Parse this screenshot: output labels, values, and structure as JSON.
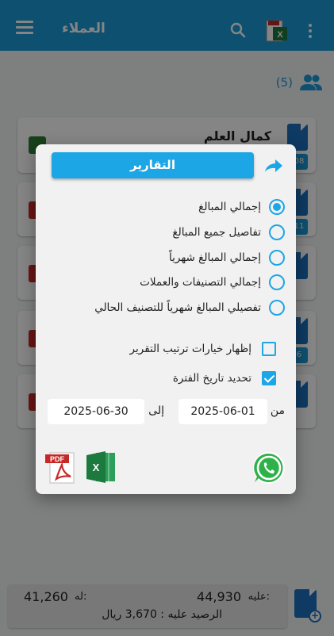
{
  "app": {
    "title": "العملاء",
    "customer_count": "(5)",
    "customers": [
      {
        "name": "كمال العلم",
        "tag": "08"
      },
      {
        "name": "",
        "tag": "11"
      },
      {
        "name": "",
        "tag": ""
      },
      {
        "name": "",
        "tag": "6"
      },
      {
        "name": "",
        "tag": ""
      }
    ],
    "totals": {
      "debit_label": "عليه:",
      "debit_value": "44,930",
      "credit_label": "له:",
      "credit_value": "41,260",
      "balance": "الرصيد عليه : 3,670 ريال"
    }
  },
  "dialog": {
    "title": "التقارير",
    "report_options": [
      {
        "label": "إجمالي المبالغ",
        "selected": true
      },
      {
        "label": "تفاصيل جميع المبالغ",
        "selected": false
      },
      {
        "label": "إجمالي المبالغ شهرياً",
        "selected": false
      },
      {
        "label": "إجمالي التصنيفات والعملات",
        "selected": false
      },
      {
        "label": "تفصيلي المبالغ شهرياً للتصنيف الحالي",
        "selected": false
      }
    ],
    "show_sort_options": {
      "label": "إظهار خيارات ترتيب التقرير",
      "checked": false
    },
    "set_period": {
      "label": "تحديد تاريخ الفترة",
      "checked": true
    },
    "date_from_label": "من",
    "date_from": "2025-06-01",
    "date_to_label": "إلى",
    "date_to": "2025-06-30",
    "icons": {
      "pdf": "pdf-icon",
      "excel": "excel-icon",
      "whatsapp": "whatsapp-icon",
      "share": "share-icon"
    }
  },
  "colors": {
    "primary": "#1c9ad6",
    "accent": "#1ca6e6",
    "doc_blue": "#1c6fbf"
  }
}
